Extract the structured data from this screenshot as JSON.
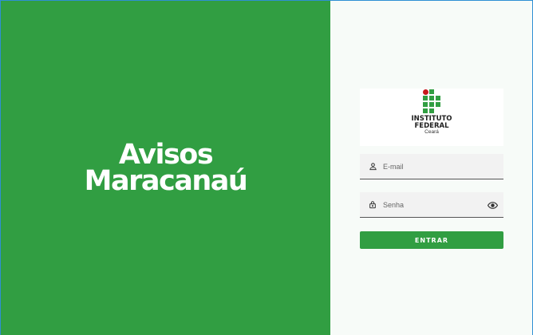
{
  "brand": {
    "line1": "Avisos",
    "line2": "Maracanaú",
    "color": "#319e42"
  },
  "logo": {
    "title_line1": "INSTITUTO",
    "title_line2": "FEDERAL",
    "subtitle": "Ceará",
    "icon": "ifce-logo-icon"
  },
  "form": {
    "email": {
      "placeholder": "E-mail",
      "icon": "person-icon"
    },
    "password": {
      "placeholder": "Senha",
      "icon": "lock-icon",
      "toggle_icon": "eye-icon"
    },
    "submit_label": "ENTRAR"
  }
}
